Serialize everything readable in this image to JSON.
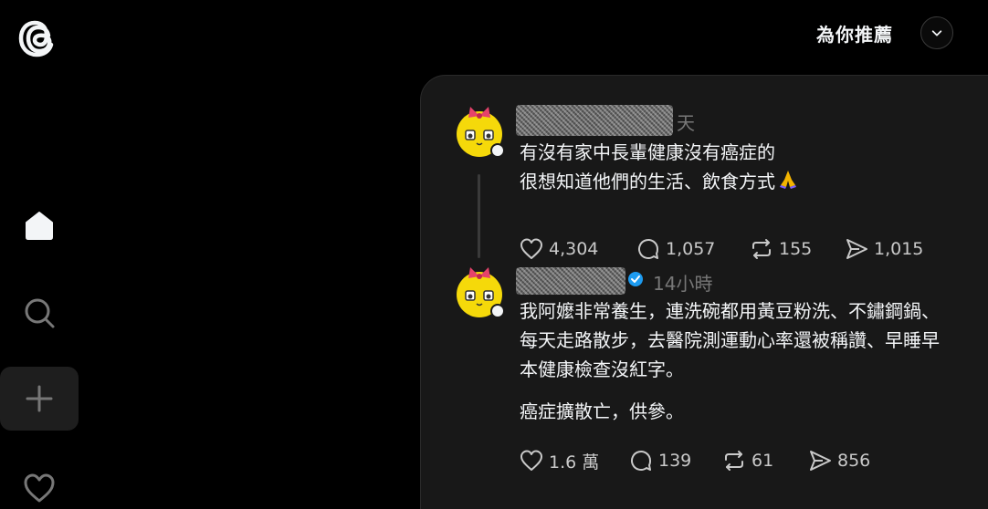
{
  "header": {
    "feed_title": "為你推薦"
  },
  "posts": [
    {
      "timestamp": "天",
      "lines": [
        "有沒有家中長輩健康沒有癌症的",
        "很想知道他們的生活、飲食方式"
      ],
      "emoji": "pray-emoji",
      "stats": {
        "likes": "4,304",
        "comments": "1,057",
        "reposts": "155",
        "shares": "1,015"
      }
    },
    {
      "timestamp": "14小時",
      "lines": [
        "我阿嬤非常養生，連洗碗都用黃豆粉洗、不鏽鋼鍋、",
        "每天走路散步，去醫院測運動心率還被稱讚、早睡早",
        "本健康檢查沒紅字。",
        "癌症擴散亡，供參。"
      ],
      "verified": true,
      "stats": {
        "likes": "1.6 萬",
        "comments": "139",
        "reposts": "61",
        "shares": "856"
      }
    }
  ],
  "icons": {
    "logo": "threads-logo-icon",
    "home": "home-icon",
    "search": "search-icon",
    "create": "plus-icon",
    "activity": "heart-icon",
    "dropdown": "chevron-down-icon"
  },
  "colors": {
    "background": "#000000",
    "card": "#181818",
    "verified": "#1d9bf0",
    "avatar_yellow": "#f5d90a",
    "bow_pink": "#e5426b"
  }
}
